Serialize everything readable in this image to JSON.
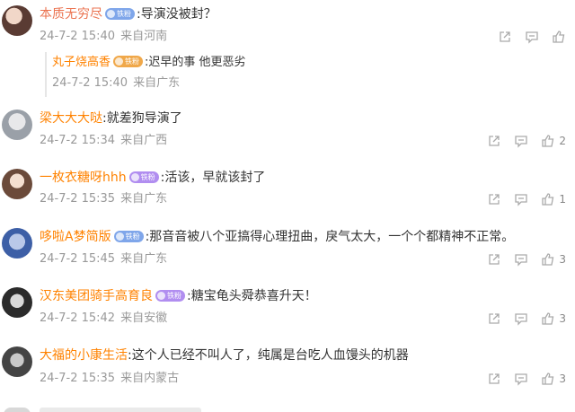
{
  "comments": [
    {
      "username": "本质无穷尽",
      "badge": "铁粉",
      "text": ":导演没被封？",
      "date": "24-7-2 15:40",
      "location": "来自河南",
      "likes": "",
      "reply": {
        "username": "丸子烧高香",
        "badge": "铁粉",
        "text": ":迟早的事 他更恶劣",
        "date": "24-7-2 15:40",
        "location": "来自广东"
      }
    },
    {
      "username": "梁大大大哒",
      "badge": "",
      "text": ":就差狗导演了",
      "date": "24-7-2 15:34",
      "location": "来自广西",
      "likes": "2"
    },
    {
      "username": "一枚衣糖呀hhh",
      "badge": "铁粉",
      "text": ":活该，早就该封了",
      "date": "24-7-2 15:35",
      "location": "来自广东",
      "likes": "1"
    },
    {
      "username": "哆啦A梦简版",
      "badge": "铁粉",
      "text": ":那音音被八个亚搞得心理扭曲，戾气太大，一个个都精神不正常。",
      "date": "24-7-2 15:45",
      "location": "来自广东",
      "likes": "3"
    },
    {
      "username": "汉东美团骑手高育良",
      "badge": "铁粉",
      "text": ":糖宝龟头舜恭喜升天！",
      "date": "24-7-2 15:42",
      "location": "来自安徽",
      "likes": "3"
    },
    {
      "username": "大福的小康生活",
      "badge": "",
      "text": ":这个人已经不叫人了，纯属是台吃人血馒头的机器",
      "date": "24-7-2 15:35",
      "location": "来自内蒙古",
      "likes": "3"
    }
  ],
  "icons": {
    "share": "share-icon",
    "comment": "comment-icon",
    "like": "like-icon"
  },
  "colors": {
    "username": "#eb7350",
    "meta": "#999999",
    "badge_blue": "#7fa6ea",
    "badge_purple": "#b18ef0",
    "badge_gold": "#f0a84a"
  }
}
